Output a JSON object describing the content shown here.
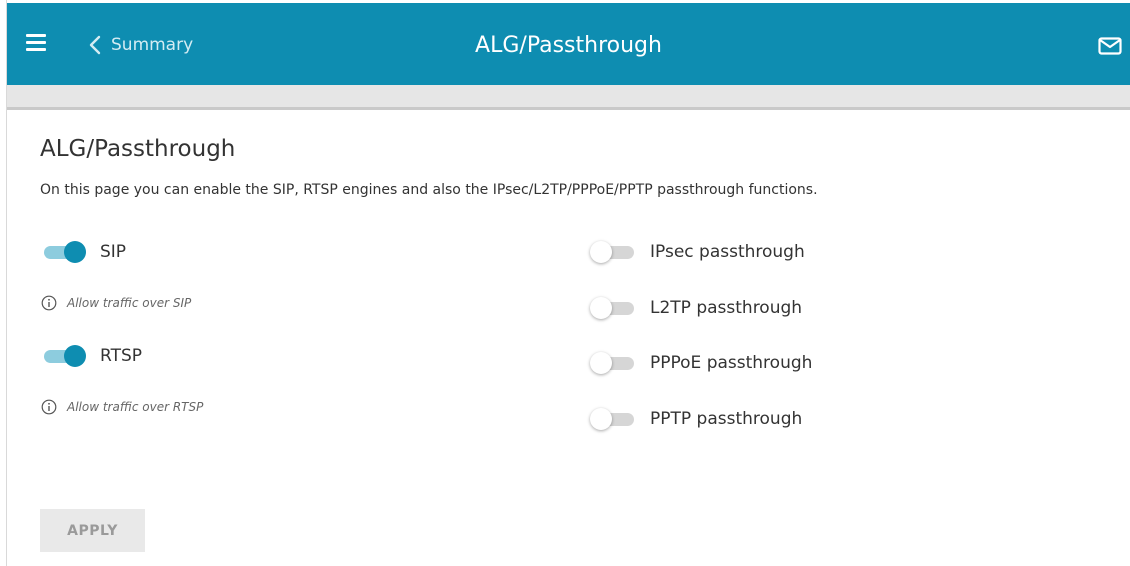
{
  "header": {
    "back_label": "Summary",
    "title": "ALG/Passthrough",
    "icons": {
      "menu": "hamburger-icon",
      "back": "chevron-left-icon",
      "mail": "mail-icon"
    }
  },
  "page": {
    "title": "ALG/Passthrough",
    "description": "On this page you can enable the SIP, RTSP engines and also the IPsec/L2TP/PPPoE/PPTP passthrough functions."
  },
  "left_toggles": [
    {
      "label": "SIP",
      "enabled": true,
      "hint": "Allow traffic over SIP"
    },
    {
      "label": "RTSP",
      "enabled": true,
      "hint": "Allow traffic over RTSP"
    }
  ],
  "right_toggles": [
    {
      "label": "IPsec passthrough",
      "enabled": false
    },
    {
      "label": "L2TP passthrough",
      "enabled": false
    },
    {
      "label": "PPPoE passthrough",
      "enabled": false
    },
    {
      "label": "PPTP passthrough",
      "enabled": false
    }
  ],
  "apply_label": "APPLY",
  "colors": {
    "accent": "#0e8db1",
    "toggle_on_track": "#8dccde",
    "toggle_off_track": "#d6d6d6",
    "button_disabled": "#e9e9e9"
  }
}
